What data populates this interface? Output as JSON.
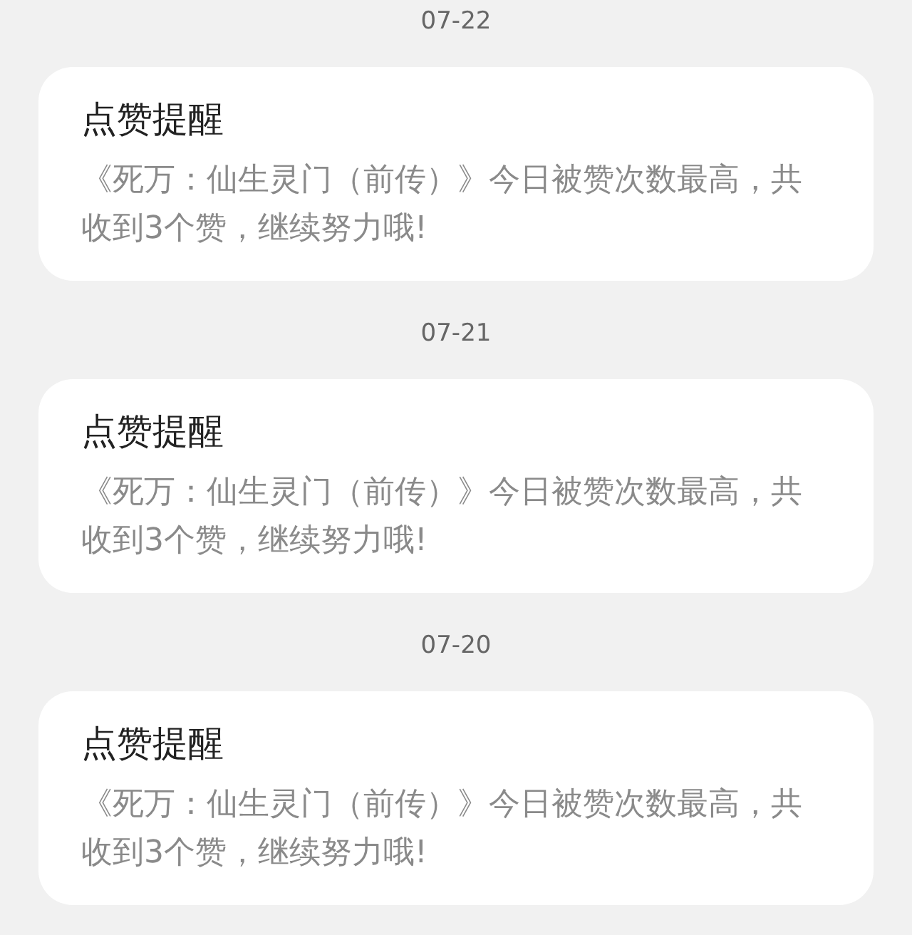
{
  "notifications": [
    {
      "date": "07-22",
      "title": "点赞提醒",
      "message": "《死万：仙生灵门（前传）》今日被赞次数最高，共收到3个赞，继续努力哦!"
    },
    {
      "date": "07-21",
      "title": "点赞提醒",
      "message": "《死万：仙生灵门（前传）》今日被赞次数最高，共收到3个赞，继续努力哦!"
    },
    {
      "date": "07-20",
      "title": "点赞提醒",
      "message": "《死万：仙生灵门（前传）》今日被赞次数最高，共收到3个赞，继续努力哦!"
    }
  ]
}
